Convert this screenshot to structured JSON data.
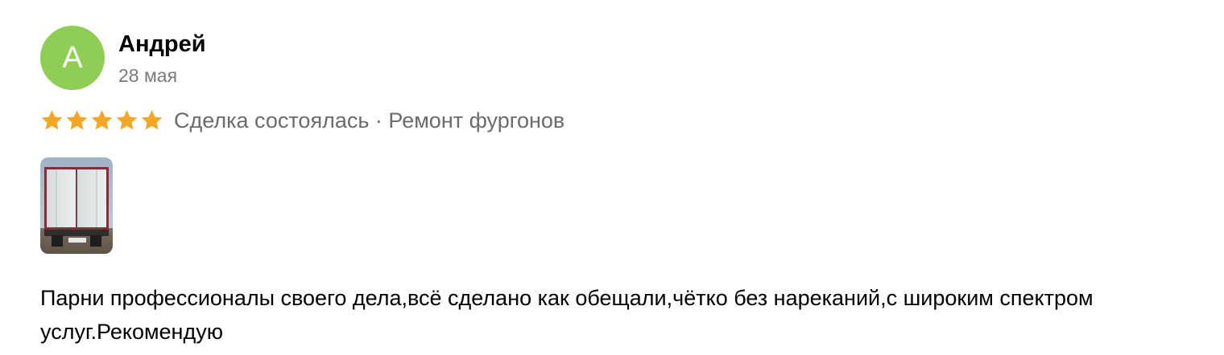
{
  "author": {
    "name": "Андрей",
    "avatar_letter": "А",
    "avatar_color": "#8fce55"
  },
  "date": "28 мая",
  "rating": {
    "stars": 5,
    "max_stars": 5,
    "star_icon": "star-icon",
    "star_color": "#f5a623"
  },
  "deal_info": "Сделка состоялась · Ремонт фургонов",
  "photo": {
    "icon": "truck-photo"
  },
  "text": "Парни профессионалы своего дела,всё сделано как обещали,чётко без нареканий,с широким спектром услуг.Рекомендую"
}
